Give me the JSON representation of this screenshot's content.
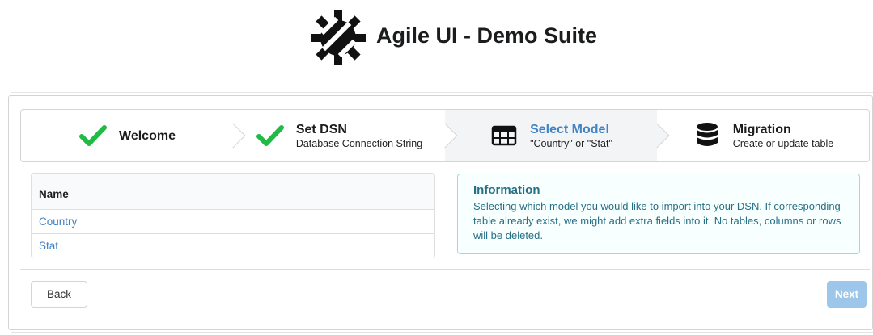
{
  "header": {
    "title": "Agile UI - Demo Suite",
    "logo_icon": "agile-logo-icon"
  },
  "wizard": {
    "steps": [
      {
        "title": "Welcome",
        "description": "",
        "icon": "checkmark-icon",
        "state": "completed"
      },
      {
        "title": "Set DSN",
        "description": "Database Connection String",
        "icon": "checkmark-icon",
        "state": "completed"
      },
      {
        "title": "Select Model",
        "description": "\"Country\" or \"Stat\"",
        "icon": "table-icon",
        "state": "active"
      },
      {
        "title": "Migration",
        "description": "Create or update table",
        "icon": "database-icon",
        "state": "pending"
      }
    ]
  },
  "table": {
    "header": "Name",
    "rows": [
      "Country",
      "Stat"
    ]
  },
  "info": {
    "heading": "Information",
    "body": "Selecting which model you would like to import into your DSN. If corresponding table already exist, we might add extra fields into it. No tables, columns or rows will be deleted."
  },
  "buttons": {
    "back": "Back",
    "next": "Next"
  },
  "colors": {
    "check": "#21ba45",
    "link": "#4183c4",
    "info_text": "#276f86",
    "next_button": "#9cc7ea"
  }
}
